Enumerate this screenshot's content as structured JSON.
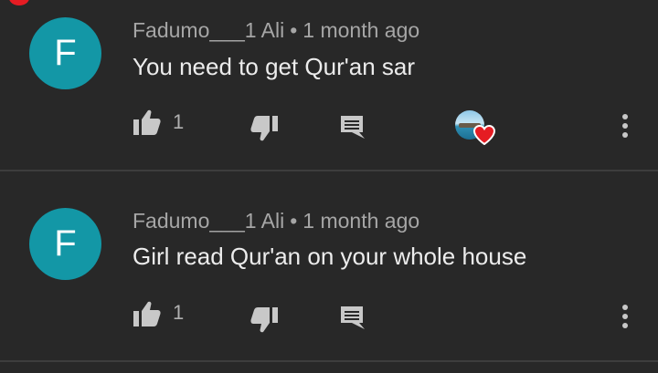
{
  "comments": [
    {
      "avatar_letter": "F",
      "author": "Fadumo___1 Ali",
      "separator": "•",
      "time": "1 month ago",
      "text": "You need to get Qur'an sar",
      "likes": "1",
      "creator_heart": true
    },
    {
      "avatar_letter": "F",
      "author": "Fadumo___1 Ali",
      "separator": "•",
      "time": "1 month ago",
      "text": "Girl read Qur'an on your whole house",
      "likes": "1",
      "creator_heart": false
    }
  ],
  "colors": {
    "background": "#282828",
    "avatar": "#1397a6",
    "heart": "#e51c23",
    "icon": "#c8c8c8",
    "meta_text": "#a6a6a6",
    "body_text": "#ececec"
  },
  "icons": [
    "thumb-up-icon",
    "thumb-down-icon",
    "reply-icon",
    "heart-icon",
    "more-vert-icon"
  ]
}
